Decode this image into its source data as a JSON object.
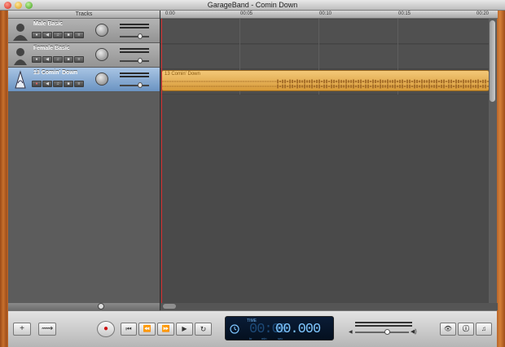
{
  "window": {
    "title": "GarageBand - Comin Down"
  },
  "headers": {
    "label": "Tracks"
  },
  "tracks": [
    {
      "name": "Male Basic",
      "avatar_icon": "male-voice-icon",
      "selected": false
    },
    {
      "name": "Female Basic",
      "avatar_icon": "female-voice-icon",
      "selected": false
    },
    {
      "name": "13 Comin' Down",
      "avatar_icon": "audio-file-icon",
      "selected": true
    }
  ],
  "ruler": {
    "ticks": [
      "0:00",
      "00:05",
      "00:10",
      "00:15",
      "00:20"
    ]
  },
  "region": {
    "name": "13 Comin' Down",
    "color": "#e6b356"
  },
  "lcd": {
    "mode": "TIME",
    "time_dim": "00:00",
    "time": "00.000",
    "sub_labels": [
      "hr",
      "min",
      "sec"
    ]
  },
  "transport": {
    "add_track": "+",
    "loop_browser": "⟿",
    "record": "●",
    "go_start": "⏮",
    "rewind": "⏪",
    "fast_forward": "⏩",
    "play": "▶",
    "cycle": "↻"
  },
  "colors": {
    "playhead": "#d52a2a",
    "lcd_text": "#7fc7ff",
    "selected_track": "#8fb3dc"
  }
}
